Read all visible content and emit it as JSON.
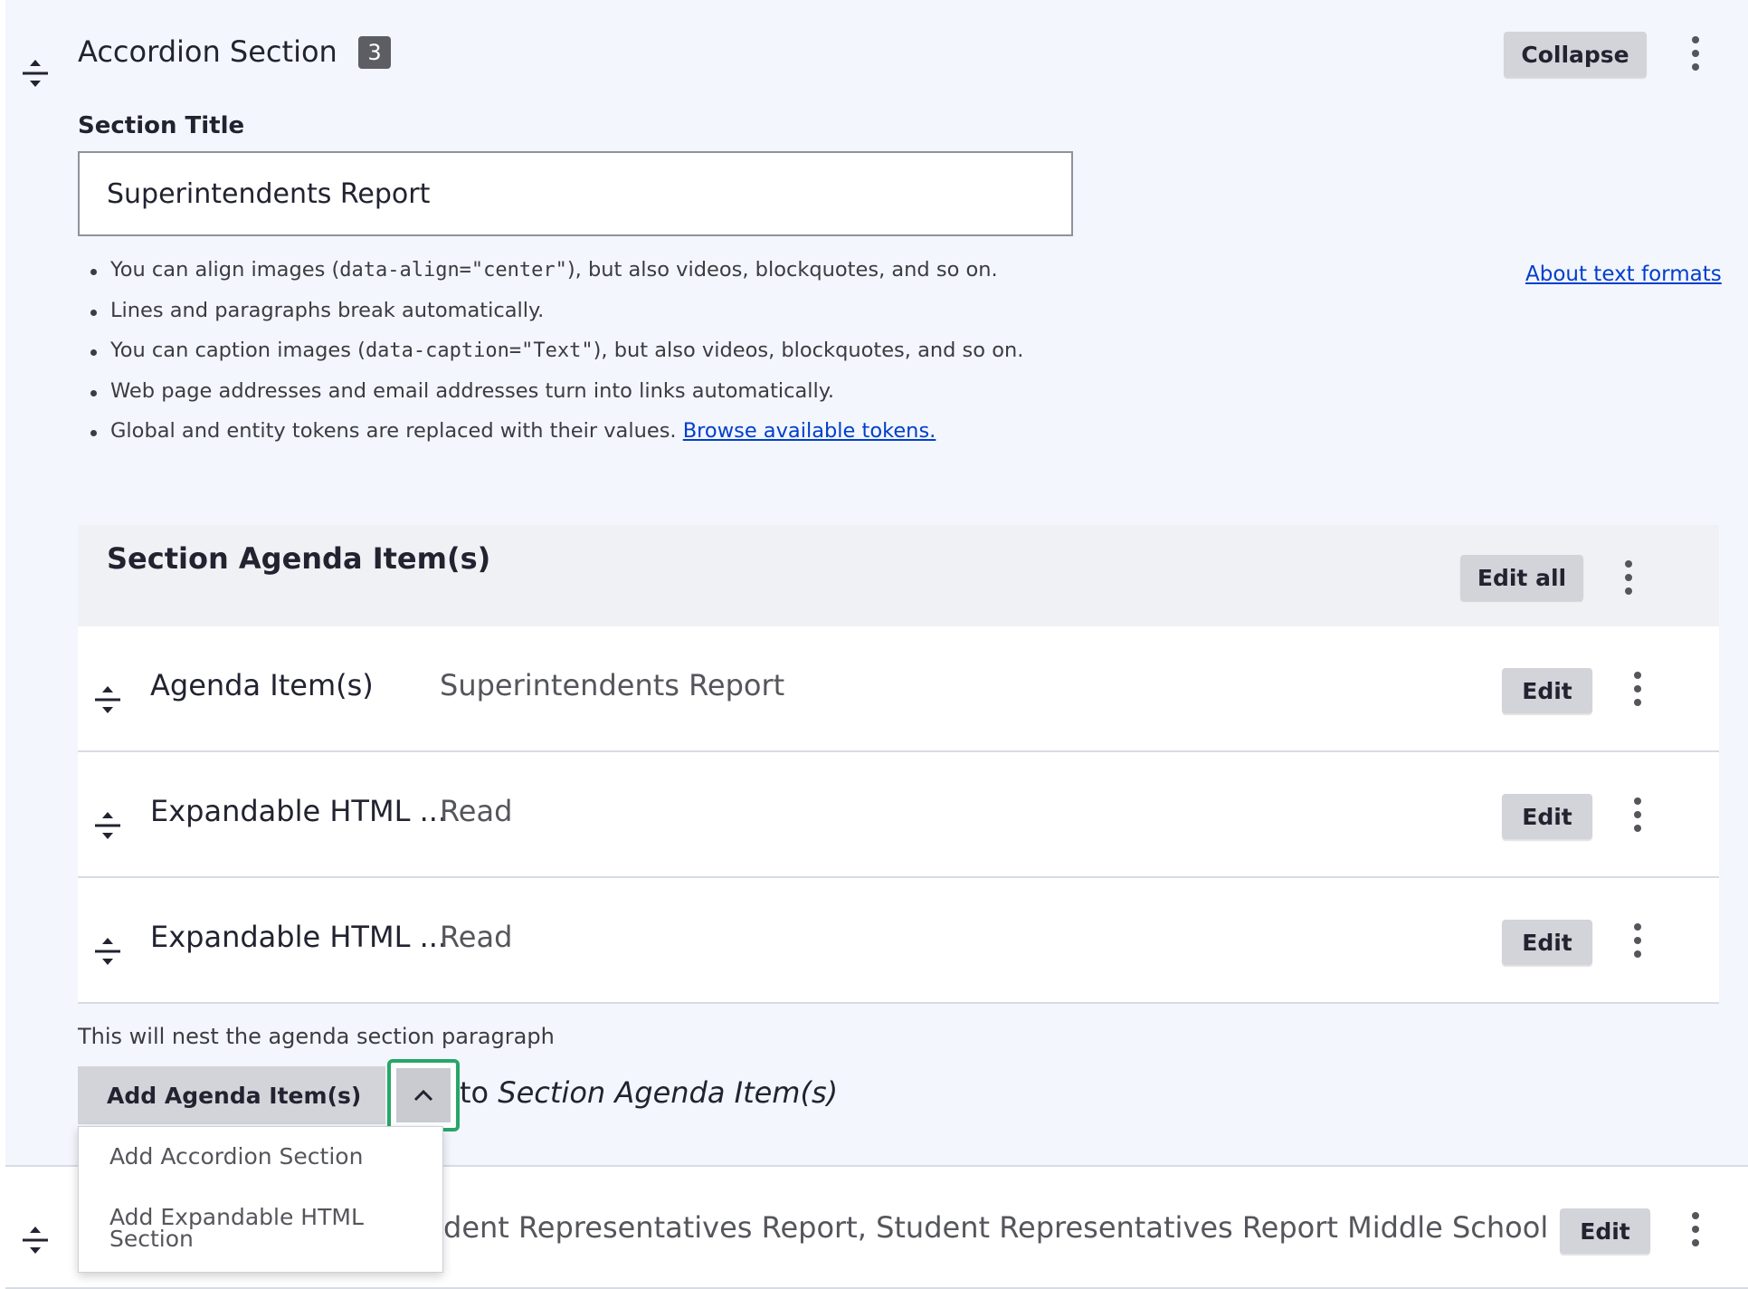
{
  "section": {
    "title": "Accordion Section",
    "badge": "3",
    "collapse_label": "Collapse"
  },
  "title_field": {
    "label": "Section Title",
    "value": "Superintendents Report"
  },
  "text_format": {
    "about_link": "About text formats",
    "tips": {
      "t1_a": "You can align images (",
      "t1_code": "data-align=\"center\"",
      "t1_b": "), but also videos, blockquotes, and so on.",
      "t2": "Lines and paragraphs break automatically.",
      "t3_a": "You can caption images (",
      "t3_code": "data-caption=\"Text\"",
      "t3_b": "), but also videos, blockquotes, and so on.",
      "t4": "Web page addresses and email addresses turn into links automatically.",
      "t5": "Global and entity tokens are replaced with their values.",
      "t5_link": "Browse available tokens."
    }
  },
  "agenda": {
    "heading": "Section Agenda Item(s)",
    "edit_all_label": "Edit all",
    "rows": [
      {
        "label": "Agenda Item(s)",
        "summary": "Superintendents Report",
        "edit": "Edit"
      },
      {
        "label": "Expandable HTML ...",
        "summary": "Read",
        "edit": "Edit"
      },
      {
        "label": "Expandable HTML ...",
        "summary": "Read",
        "edit": "Edit"
      }
    ]
  },
  "add": {
    "description": "This will nest the agenda section paragraph",
    "button_label": "Add Agenda Item(s)",
    "to_text": "to",
    "target": "Section Agenda Item(s)",
    "dropdown": [
      "Add Accordion Section",
      "Add Expandable HTML Section"
    ]
  },
  "bottom_row": {
    "summary": "dent Representatives Report, Student Representatives Report Middle School Repr...",
    "edit": "Edit"
  }
}
